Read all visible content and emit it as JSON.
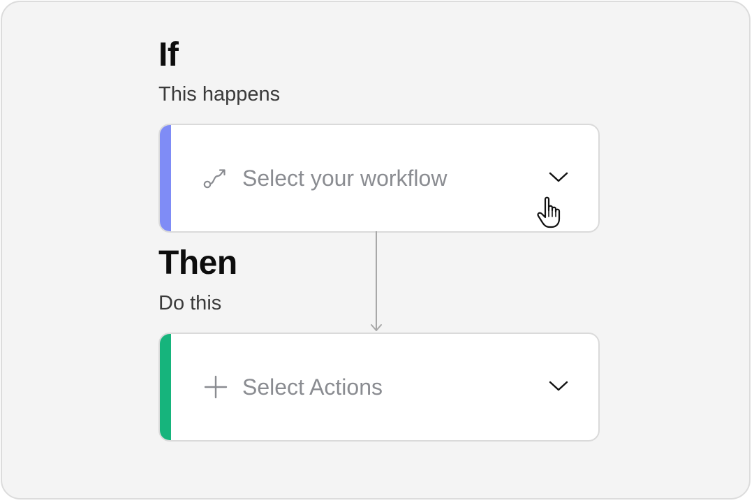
{
  "if_section": {
    "title": "If",
    "subtitle": "This happens",
    "selector": {
      "placeholder": "Select your workflow",
      "icon": "workflow-route-icon",
      "accent_color": "#7f8cf6"
    }
  },
  "then_section": {
    "title": "Then",
    "subtitle": "Do this",
    "selector": {
      "placeholder": "Select Actions",
      "icon": "plus-icon",
      "accent_color": "#16b47c"
    }
  },
  "colors": {
    "background": "#f4f4f4",
    "card": "#ffffff",
    "card_border": "#dadada",
    "placeholder_text": "#8a8c91",
    "connector": "#a8a8a8"
  }
}
